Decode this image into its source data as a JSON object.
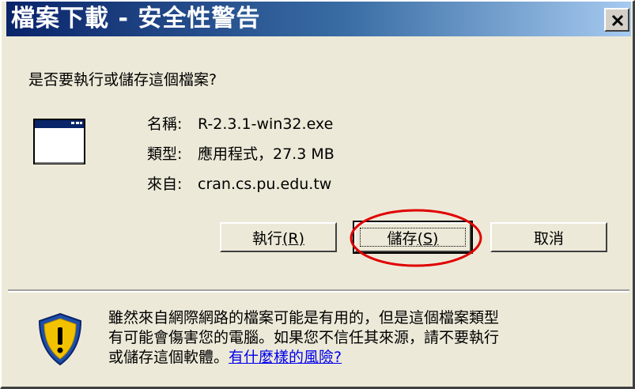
{
  "window": {
    "title": "檔案下載 - 安全性警告",
    "close_label": "×"
  },
  "question": "是否要執行或儲存這個檔案?",
  "file": {
    "icon": "application-window-icon",
    "rows": [
      {
        "label": "名稱:",
        "value": "R-2.3.1-win32.exe"
      },
      {
        "label": "類型:",
        "value": "應用程式，27.3 MB"
      },
      {
        "label": "來自:",
        "value": "cran.cs.pu.edu.tw"
      }
    ]
  },
  "buttons": {
    "run": {
      "label": "執行",
      "accel": "(R)"
    },
    "save": {
      "label": "儲存",
      "accel": "(S)"
    },
    "cancel": {
      "label": "取消"
    }
  },
  "warning": {
    "icon": "security-shield-icon",
    "line1": "雖然來自網際網路的檔案可能是有用的，但是這個檔案類型",
    "line2": "有可能會傷害您的電腦。如果您不信任其來源，請不要執行",
    "line3": "或儲存這個軟體。",
    "link": "有什麼樣的風險?"
  },
  "colors": {
    "dialog_bg": "#ece9d8",
    "titlebar_start": "#0a246a",
    "titlebar_end": "#a6caf0",
    "highlight_ellipse": "#e00000",
    "link": "#0000ee"
  }
}
